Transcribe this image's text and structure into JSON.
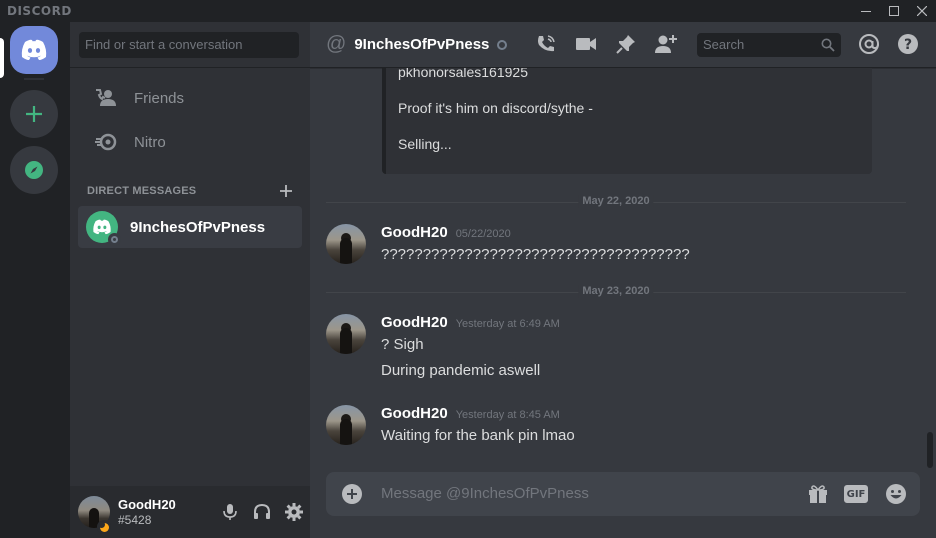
{
  "app": {
    "brand": "DISCORD"
  },
  "sidebar": {
    "search_placeholder": "Find or start a conversation",
    "nav": [
      {
        "label": "Friends",
        "icon": "friends-icon"
      },
      {
        "label": "Nitro",
        "icon": "nitro-icon"
      }
    ],
    "dm_header": "DIRECT MESSAGES",
    "dms": [
      {
        "name": "9InchesOfPvPness",
        "status": "offline"
      }
    ]
  },
  "user": {
    "name": "GoodH20",
    "tag": "#5428",
    "status": "idle"
  },
  "header": {
    "channel": "9InchesOfPvPness",
    "search_placeholder": "Search"
  },
  "embed": {
    "lines": [
      "pkhonorsales161925",
      "Proof it's him on discord/sythe -",
      "Selling..."
    ]
  },
  "messages": {
    "day1": "May 22, 2020",
    "m1": {
      "author": "GoodH20",
      "time": "05/22/2020",
      "lines": [
        "?????????????????????????????????????"
      ]
    },
    "day2": "May 23, 2020",
    "m2": {
      "author": "GoodH20",
      "time": "Yesterday at 6:49 AM",
      "lines": [
        "? Sigh",
        "During pandemic aswell"
      ]
    },
    "m3": {
      "author": "GoodH20",
      "time": "Yesterday at 8:45 AM",
      "lines": [
        "Waiting for the bank pin lmao"
      ]
    }
  },
  "composer": {
    "placeholder": "Message @9InchesOfPvPness",
    "gif_label": "GIF"
  },
  "colors": {
    "blurple": "#7289da",
    "green": "#43b581",
    "idle": "#faa61a",
    "bg_main": "#36393f",
    "bg_sidebar": "#2f3136",
    "bg_dark": "#202225"
  }
}
